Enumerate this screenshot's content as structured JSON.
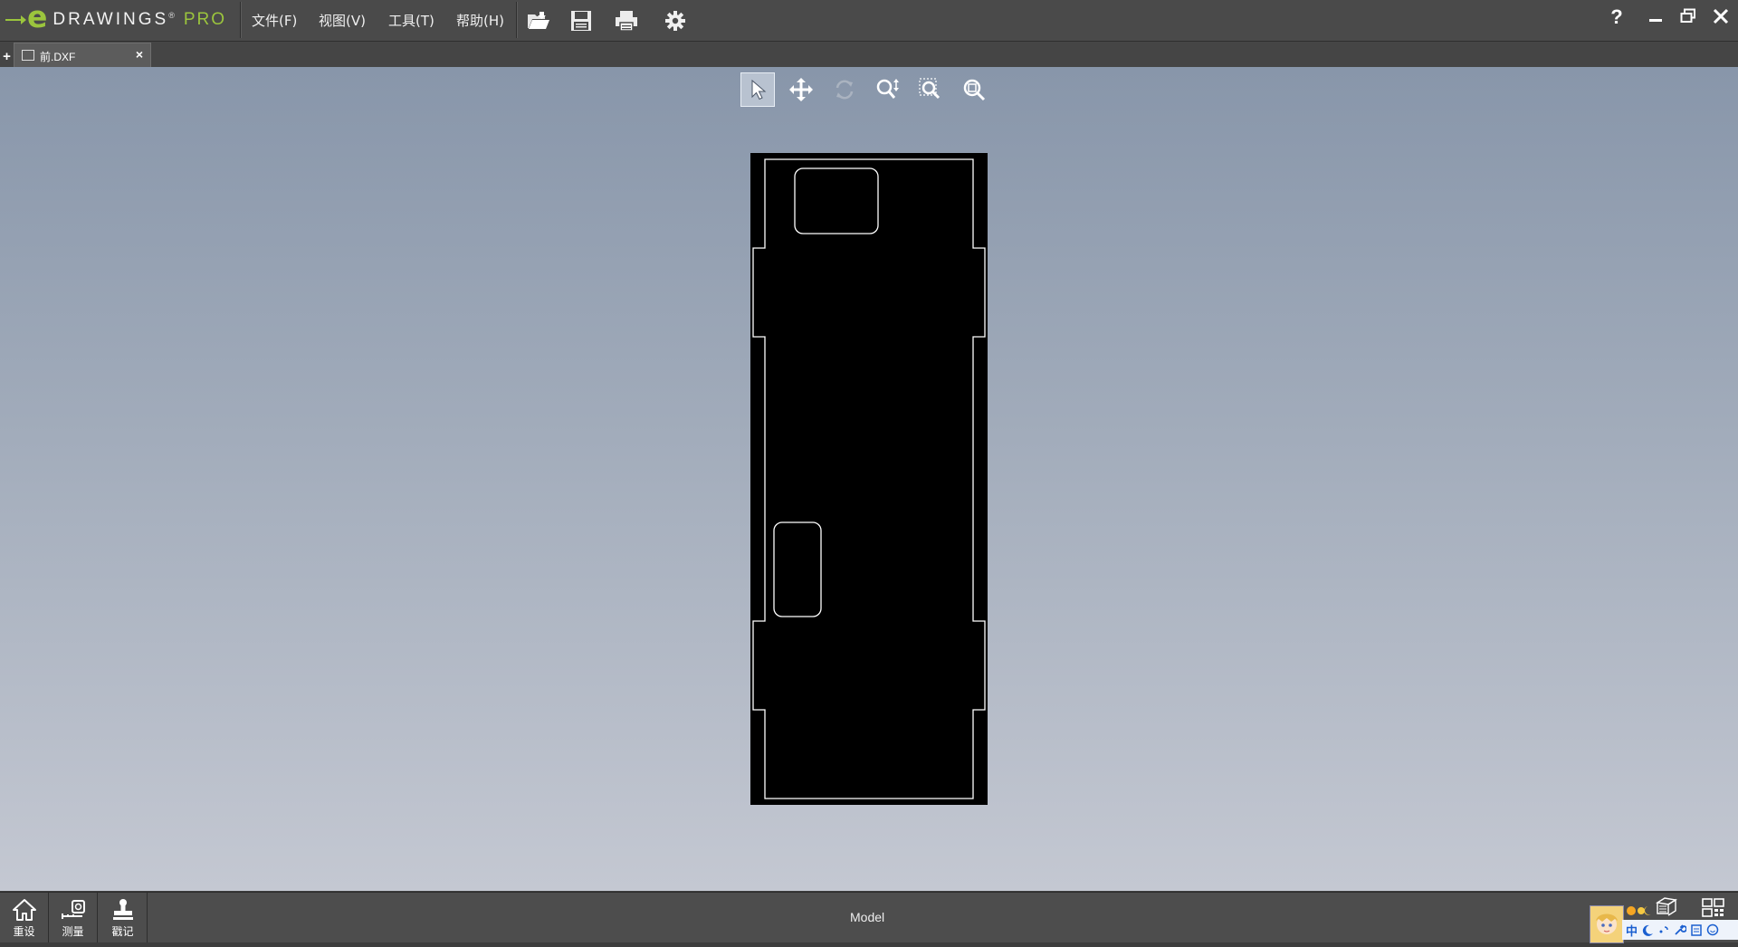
{
  "app": {
    "logo_word": "DRAWINGS",
    "logo_reg": "®",
    "logo_pro": "PRO",
    "brand_color": "#9bc53d"
  },
  "menu": [
    {
      "label": "文件(F)"
    },
    {
      "label": "视图(V)"
    },
    {
      "label": "工具(T)"
    },
    {
      "label": "帮助(H)"
    }
  ],
  "toolbar": {
    "icons": [
      "open-folder-icon",
      "save-icon",
      "print-icon",
      "settings-gear-icon"
    ]
  },
  "window_controls": {
    "help": "?",
    "icons": [
      "minimize-icon",
      "restore-icon",
      "close-icon"
    ]
  },
  "tabs": {
    "add_label": "+",
    "document": {
      "label": "前.DXF",
      "close": "×"
    }
  },
  "view_toolbar": {
    "tools": [
      "select-arrow-icon",
      "pan-move-icon",
      "rotate-icon",
      "zoom-realtime-icon",
      "zoom-window-icon",
      "zoom-fit-icon"
    ],
    "active": "select-arrow-icon"
  },
  "bottom": {
    "buttons": [
      {
        "label": "重设",
        "icon": "home-reset-icon"
      },
      {
        "label": "测量",
        "icon": "measure-icon"
      },
      {
        "label": "戳记",
        "icon": "stamp-icon"
      }
    ],
    "status_text": "Model",
    "tray_text": "中"
  }
}
